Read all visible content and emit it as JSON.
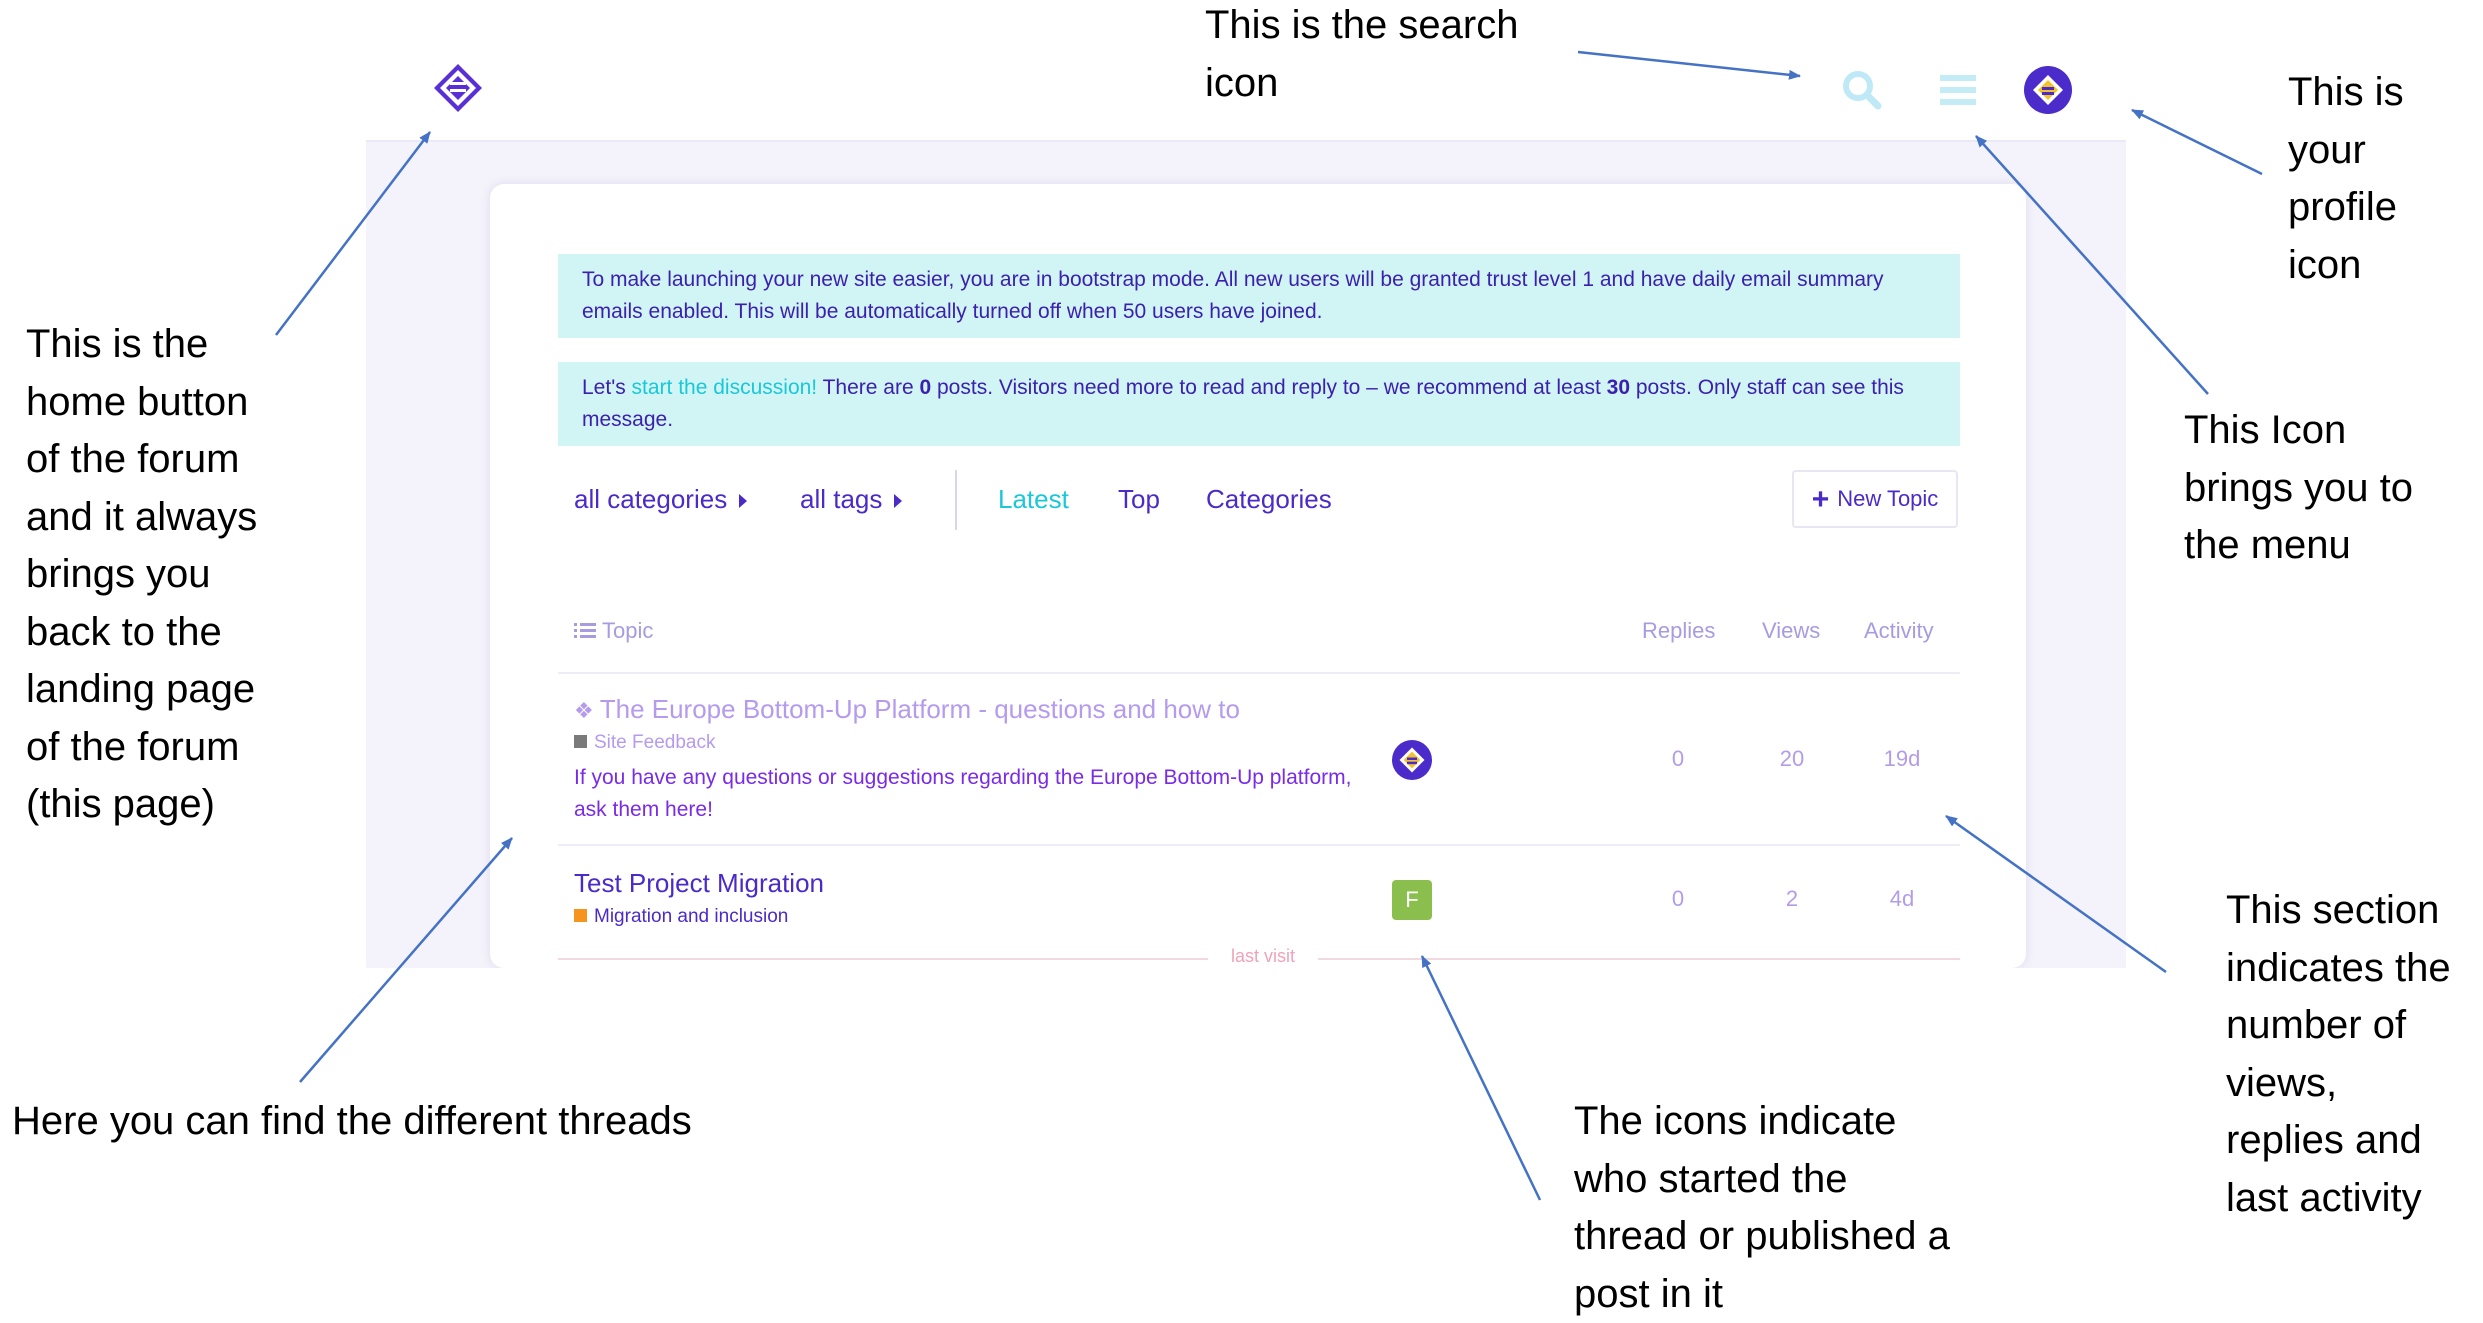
{
  "annotations": {
    "search": [
      "This is the search",
      "icon"
    ],
    "profile": [
      "This is",
      "your",
      "profile",
      "icon"
    ],
    "home": [
      "This is the",
      "home button",
      "of the forum",
      "and it always",
      "brings you",
      "back to the",
      "landing page",
      "of the forum",
      "(this page)"
    ],
    "menu": [
      "This Icon",
      "brings you to",
      "the menu"
    ],
    "threads": "Here you can find the different threads",
    "stats": [
      "This section",
      "indicates the",
      "number of",
      "views,",
      "replies and",
      "last activity"
    ],
    "avatars": [
      "The icons indicate",
      "who started the",
      "thread or published a",
      "post in it"
    ]
  },
  "header": {
    "logo": "forum-logo-icon",
    "search_icon": "search-icon",
    "menu_icon": "hamburger-menu-icon",
    "profile_icon": "profile-avatar-icon"
  },
  "notices": {
    "bootstrap": "To make launching your new site easier, you are in bootstrap mode. All new users will be granted trust level 1 and have daily email summary emails enabled. This will be automatically turned off when 50 users have joined.",
    "discussion": {
      "prefix": "Let's ",
      "link": "start the discussion!",
      "part1": " There are ",
      "posts": "0",
      "part2": " posts. Visitors need more to read and reply to – we recommend at least ",
      "recommended": "30",
      "part3": " posts. Only staff can see this message."
    }
  },
  "nav": {
    "categories_dropdown": "all categories",
    "tags_dropdown": "all tags",
    "tabs": [
      "Latest",
      "Top",
      "Categories"
    ],
    "new_topic": "New Topic"
  },
  "table": {
    "columns": {
      "topic": "Topic",
      "replies": "Replies",
      "views": "Views",
      "activity": "Activity"
    },
    "rows": [
      {
        "title": "The Europe Bottom-Up Platform - questions and how to",
        "category": "Site Feedback",
        "category_color": "#808080",
        "excerpt": "If you have any questions or suggestions regarding the Europe Bottom-Up platform, ask them here!",
        "pinned": true,
        "replies": "0",
        "views": "20",
        "activity": "19d"
      },
      {
        "title": "Test Project Migration",
        "category": "Migration and inclusion",
        "category_color": "#f7941d",
        "avatar_letter": "F",
        "replies": "0",
        "views": "2",
        "activity": "4d"
      }
    ],
    "last_visit": "last visit"
  },
  "colors": {
    "brand": "#4a2bc8",
    "notice_bg": "#d1f4f4",
    "link_cyan": "#1bc8d8",
    "arrow": "#4472c4"
  }
}
